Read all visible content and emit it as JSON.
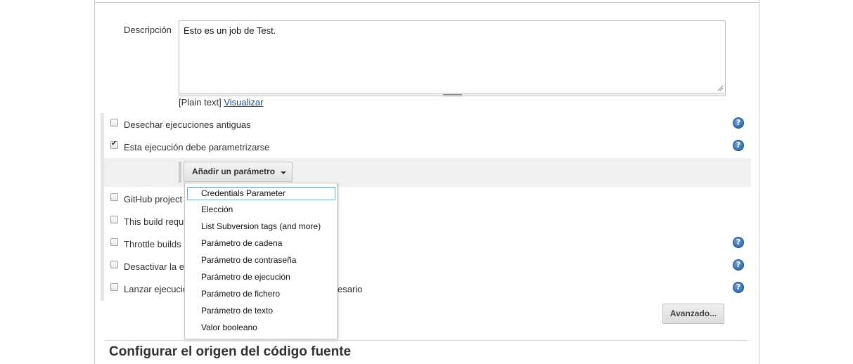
{
  "description": {
    "label": "Descripción",
    "value": "Esto es un job de Test.",
    "format_prefix": "[Plain text]",
    "preview_link": "Visualizar"
  },
  "options": [
    {
      "label": "Desechar ejecuciones antiguas",
      "checked": false,
      "help": true
    },
    {
      "label": "Esta ejecución debe parametrizarse",
      "checked": true,
      "help": true
    },
    {
      "label": "GitHub project",
      "checked": false,
      "help": false
    },
    {
      "label": "This build requ",
      "checked": false,
      "help": false
    },
    {
      "label": "Throttle builds",
      "checked": false,
      "help": true
    },
    {
      "label": "Desactivar la e",
      "checked": false,
      "help": true
    },
    {
      "label": "Lanzar ejecució",
      "label_tail": "esario",
      "checked": false,
      "help": true
    }
  ],
  "add_parameter": {
    "label": "Añadir un parámetro"
  },
  "parameter_menu": [
    "Credentials Parameter",
    "Elección",
    "List Subversion tags (and more)",
    "Parámetro de cadena",
    "Parámetro de contraseña",
    "Parámetro de ejecución",
    "Parámetro de fichero",
    "Parámetro de texto",
    "Valor booleano"
  ],
  "advanced_button": "Avanzado...",
  "section_title": "Configurar el origen del código fuente",
  "help_glyph": "?",
  "colors": {
    "link": "#204a87",
    "help_icon": "#1e5aa0",
    "menu_focus": "#7aa7d9"
  }
}
